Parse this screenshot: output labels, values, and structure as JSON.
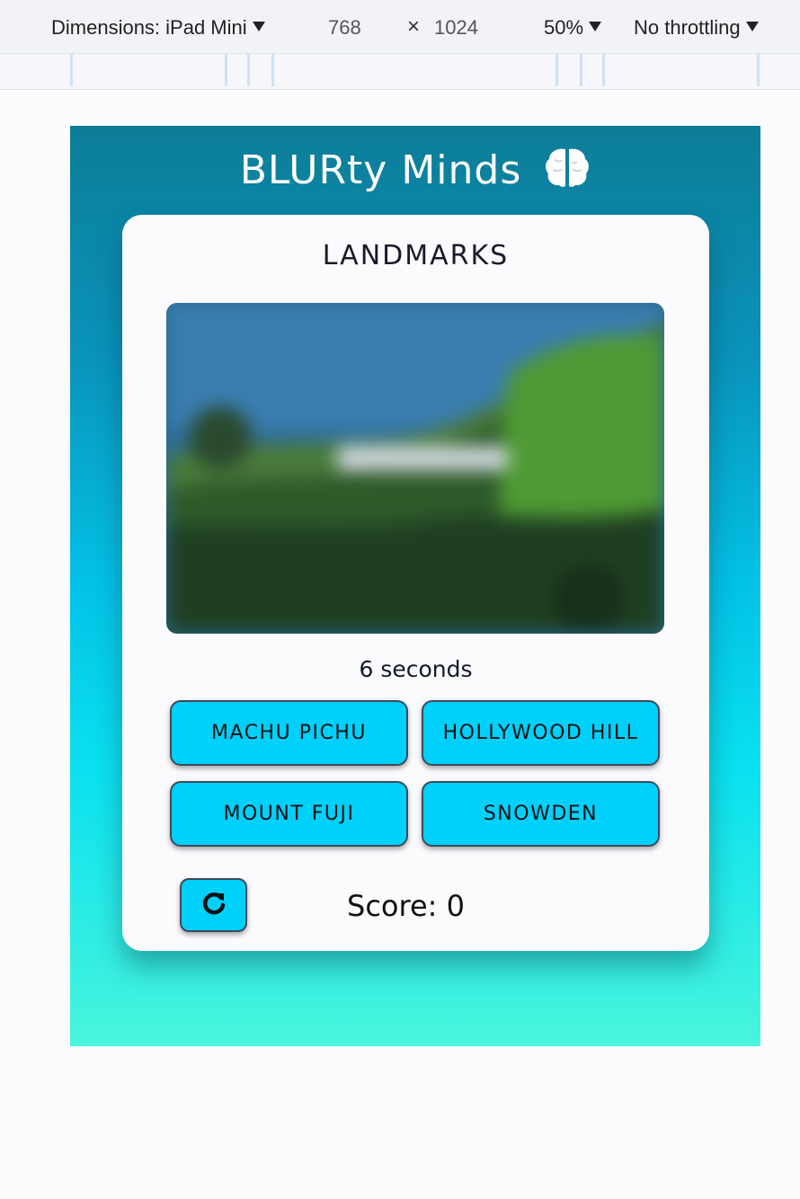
{
  "devtools": {
    "dimensions_label": "Dimensions: iPad Mini",
    "width": "768",
    "times": "×",
    "height": "1024",
    "zoom": "50%",
    "throttling": "No throttling"
  },
  "app": {
    "title": "BLURty Minds",
    "title_icon": "brain-icon"
  },
  "quiz": {
    "category": "LANDMARKS",
    "timer_text": "6 seconds",
    "answers": [
      "MACHU PICHU",
      "HOLLYWOOD HILL",
      "MOUNT FUJI",
      "SNOWDEN"
    ],
    "restart_icon": "restart-icon",
    "score_text": "Score: 0"
  },
  "colors": {
    "button": "#00d0fa",
    "gradient_top": "#0c7d97",
    "gradient_bottom": "#48f5dc"
  }
}
